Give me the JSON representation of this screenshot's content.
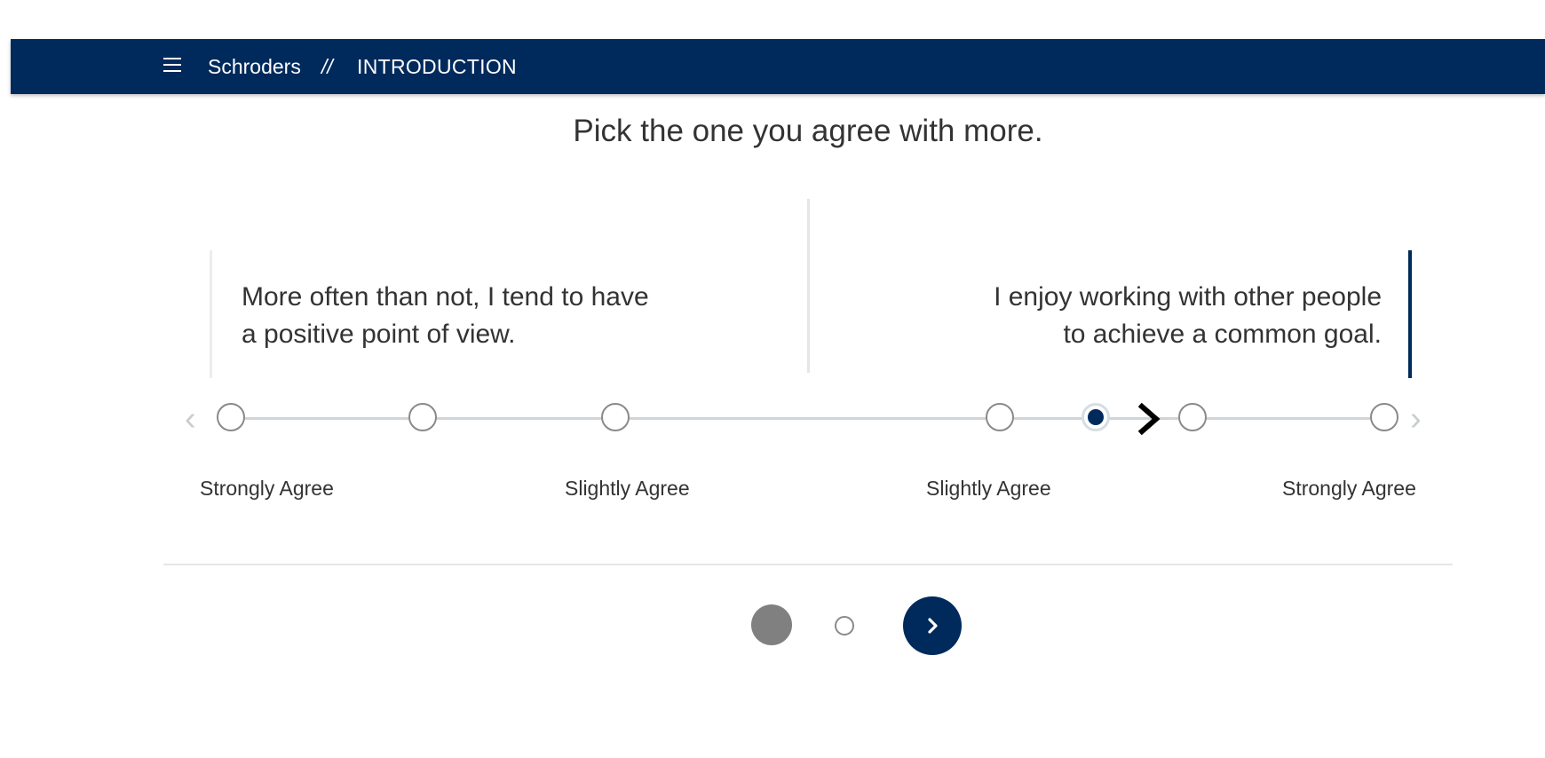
{
  "header": {
    "brand": "Schroders",
    "separator": "//",
    "section": "INTRODUCTION",
    "background_color": "#002a5c"
  },
  "prompt": "Pick the one you agree with more.",
  "statements": {
    "left": {
      "line1": "More often than not, I tend to have",
      "line2": "a positive point of view."
    },
    "right": {
      "line1": "I enjoy working with other people",
      "line2": "to achieve a common goal."
    }
  },
  "scale": {
    "point_count": 7,
    "selected_index": 4,
    "labels": [
      "Strongly Agree",
      "Slightly Agree",
      "Slightly Agree",
      "Strongly Agree"
    ],
    "accent_color": "#002a5c"
  },
  "pager": {
    "page_count": 2,
    "current_page": 1
  },
  "icons": {
    "menu": "hamburger-menu-icon",
    "scale_left": "chevron-left-icon",
    "scale_right": "chevron-right-icon",
    "pointer": "chevron-right-icon",
    "next": "chevron-right-icon"
  }
}
